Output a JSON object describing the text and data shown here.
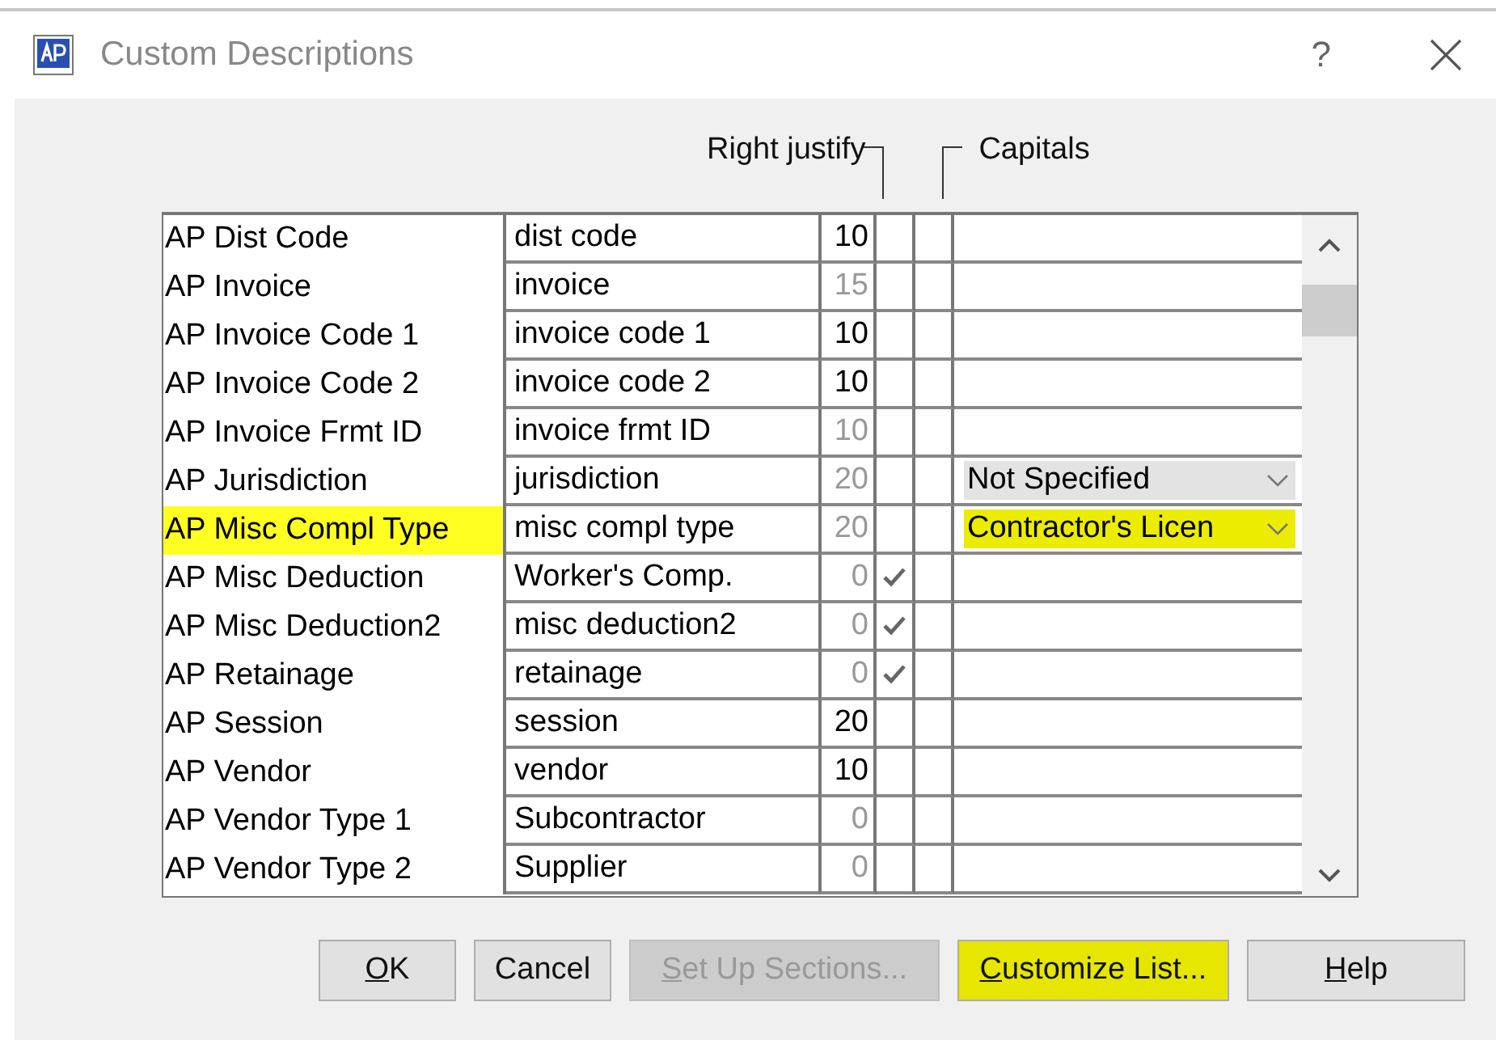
{
  "window": {
    "title": "Custom Descriptions",
    "help": "?"
  },
  "headers": {
    "right_justify": "Right justify",
    "capitals": "Capitals"
  },
  "rows": [
    {
      "name": "AP Dist Code",
      "description": "dist code",
      "length": "10",
      "length_disabled": false,
      "right_justify": false,
      "capitals": false,
      "highlighted": false
    },
    {
      "name": "AP Invoice",
      "description": "invoice",
      "length": "15",
      "length_disabled": true,
      "right_justify": false,
      "capitals": false,
      "highlighted": false
    },
    {
      "name": "AP Invoice Code 1",
      "description": "invoice code 1",
      "length": "10",
      "length_disabled": false,
      "right_justify": false,
      "capitals": false,
      "highlighted": false
    },
    {
      "name": "AP Invoice Code 2",
      "description": "invoice code 2",
      "length": "10",
      "length_disabled": false,
      "right_justify": false,
      "capitals": false,
      "highlighted": false
    },
    {
      "name": "AP Invoice Frmt ID",
      "description": "invoice frmt ID",
      "length": "10",
      "length_disabled": true,
      "right_justify": false,
      "capitals": false,
      "highlighted": false
    },
    {
      "name": "AP Jurisdiction",
      "description": "jurisdiction",
      "length": "20",
      "length_disabled": true,
      "right_justify": false,
      "capitals": false,
      "highlighted": false,
      "dropdown": {
        "value": "Not Specified",
        "highlighted": false
      }
    },
    {
      "name": "AP Misc Compl Type",
      "description": "misc compl type",
      "length": "20",
      "length_disabled": true,
      "right_justify": false,
      "capitals": false,
      "highlighted": true,
      "dropdown": {
        "value": "Contractor's Licen",
        "highlighted": true
      }
    },
    {
      "name": "AP Misc Deduction",
      "description": "Worker's Comp.",
      "length": "0",
      "length_disabled": true,
      "right_justify": true,
      "capitals": false,
      "highlighted": false
    },
    {
      "name": "AP Misc Deduction2",
      "description": "misc deduction2",
      "length": "0",
      "length_disabled": true,
      "right_justify": true,
      "capitals": false,
      "highlighted": false
    },
    {
      "name": "AP Retainage",
      "description": "retainage",
      "length": "0",
      "length_disabled": true,
      "right_justify": true,
      "capitals": false,
      "highlighted": false
    },
    {
      "name": "AP Session",
      "description": "session",
      "length": "20",
      "length_disabled": false,
      "right_justify": false,
      "capitals": false,
      "highlighted": false
    },
    {
      "name": "AP Vendor",
      "description": "vendor",
      "length": "10",
      "length_disabled": false,
      "right_justify": false,
      "capitals": false,
      "highlighted": false
    },
    {
      "name": "AP Vendor Type 1",
      "description": "Subcontractor",
      "length": "0",
      "length_disabled": true,
      "right_justify": false,
      "capitals": false,
      "highlighted": false
    },
    {
      "name": "AP Vendor Type 2",
      "description": "Supplier",
      "length": "0",
      "length_disabled": true,
      "right_justify": false,
      "capitals": false,
      "highlighted": false
    }
  ],
  "buttons": [
    {
      "label": "OK",
      "disabled": false,
      "highlighted": false,
      "mnemonic": true
    },
    {
      "label": "Cancel",
      "disabled": false,
      "highlighted": false,
      "mnemonic": false
    },
    {
      "label": "Set Up Sections...",
      "disabled": true,
      "highlighted": false,
      "mnemonic": true
    },
    {
      "label": "Customize List...",
      "disabled": false,
      "highlighted": true,
      "mnemonic": true
    },
    {
      "label": "Help",
      "disabled": false,
      "highlighted": false,
      "mnemonic": true
    }
  ]
}
